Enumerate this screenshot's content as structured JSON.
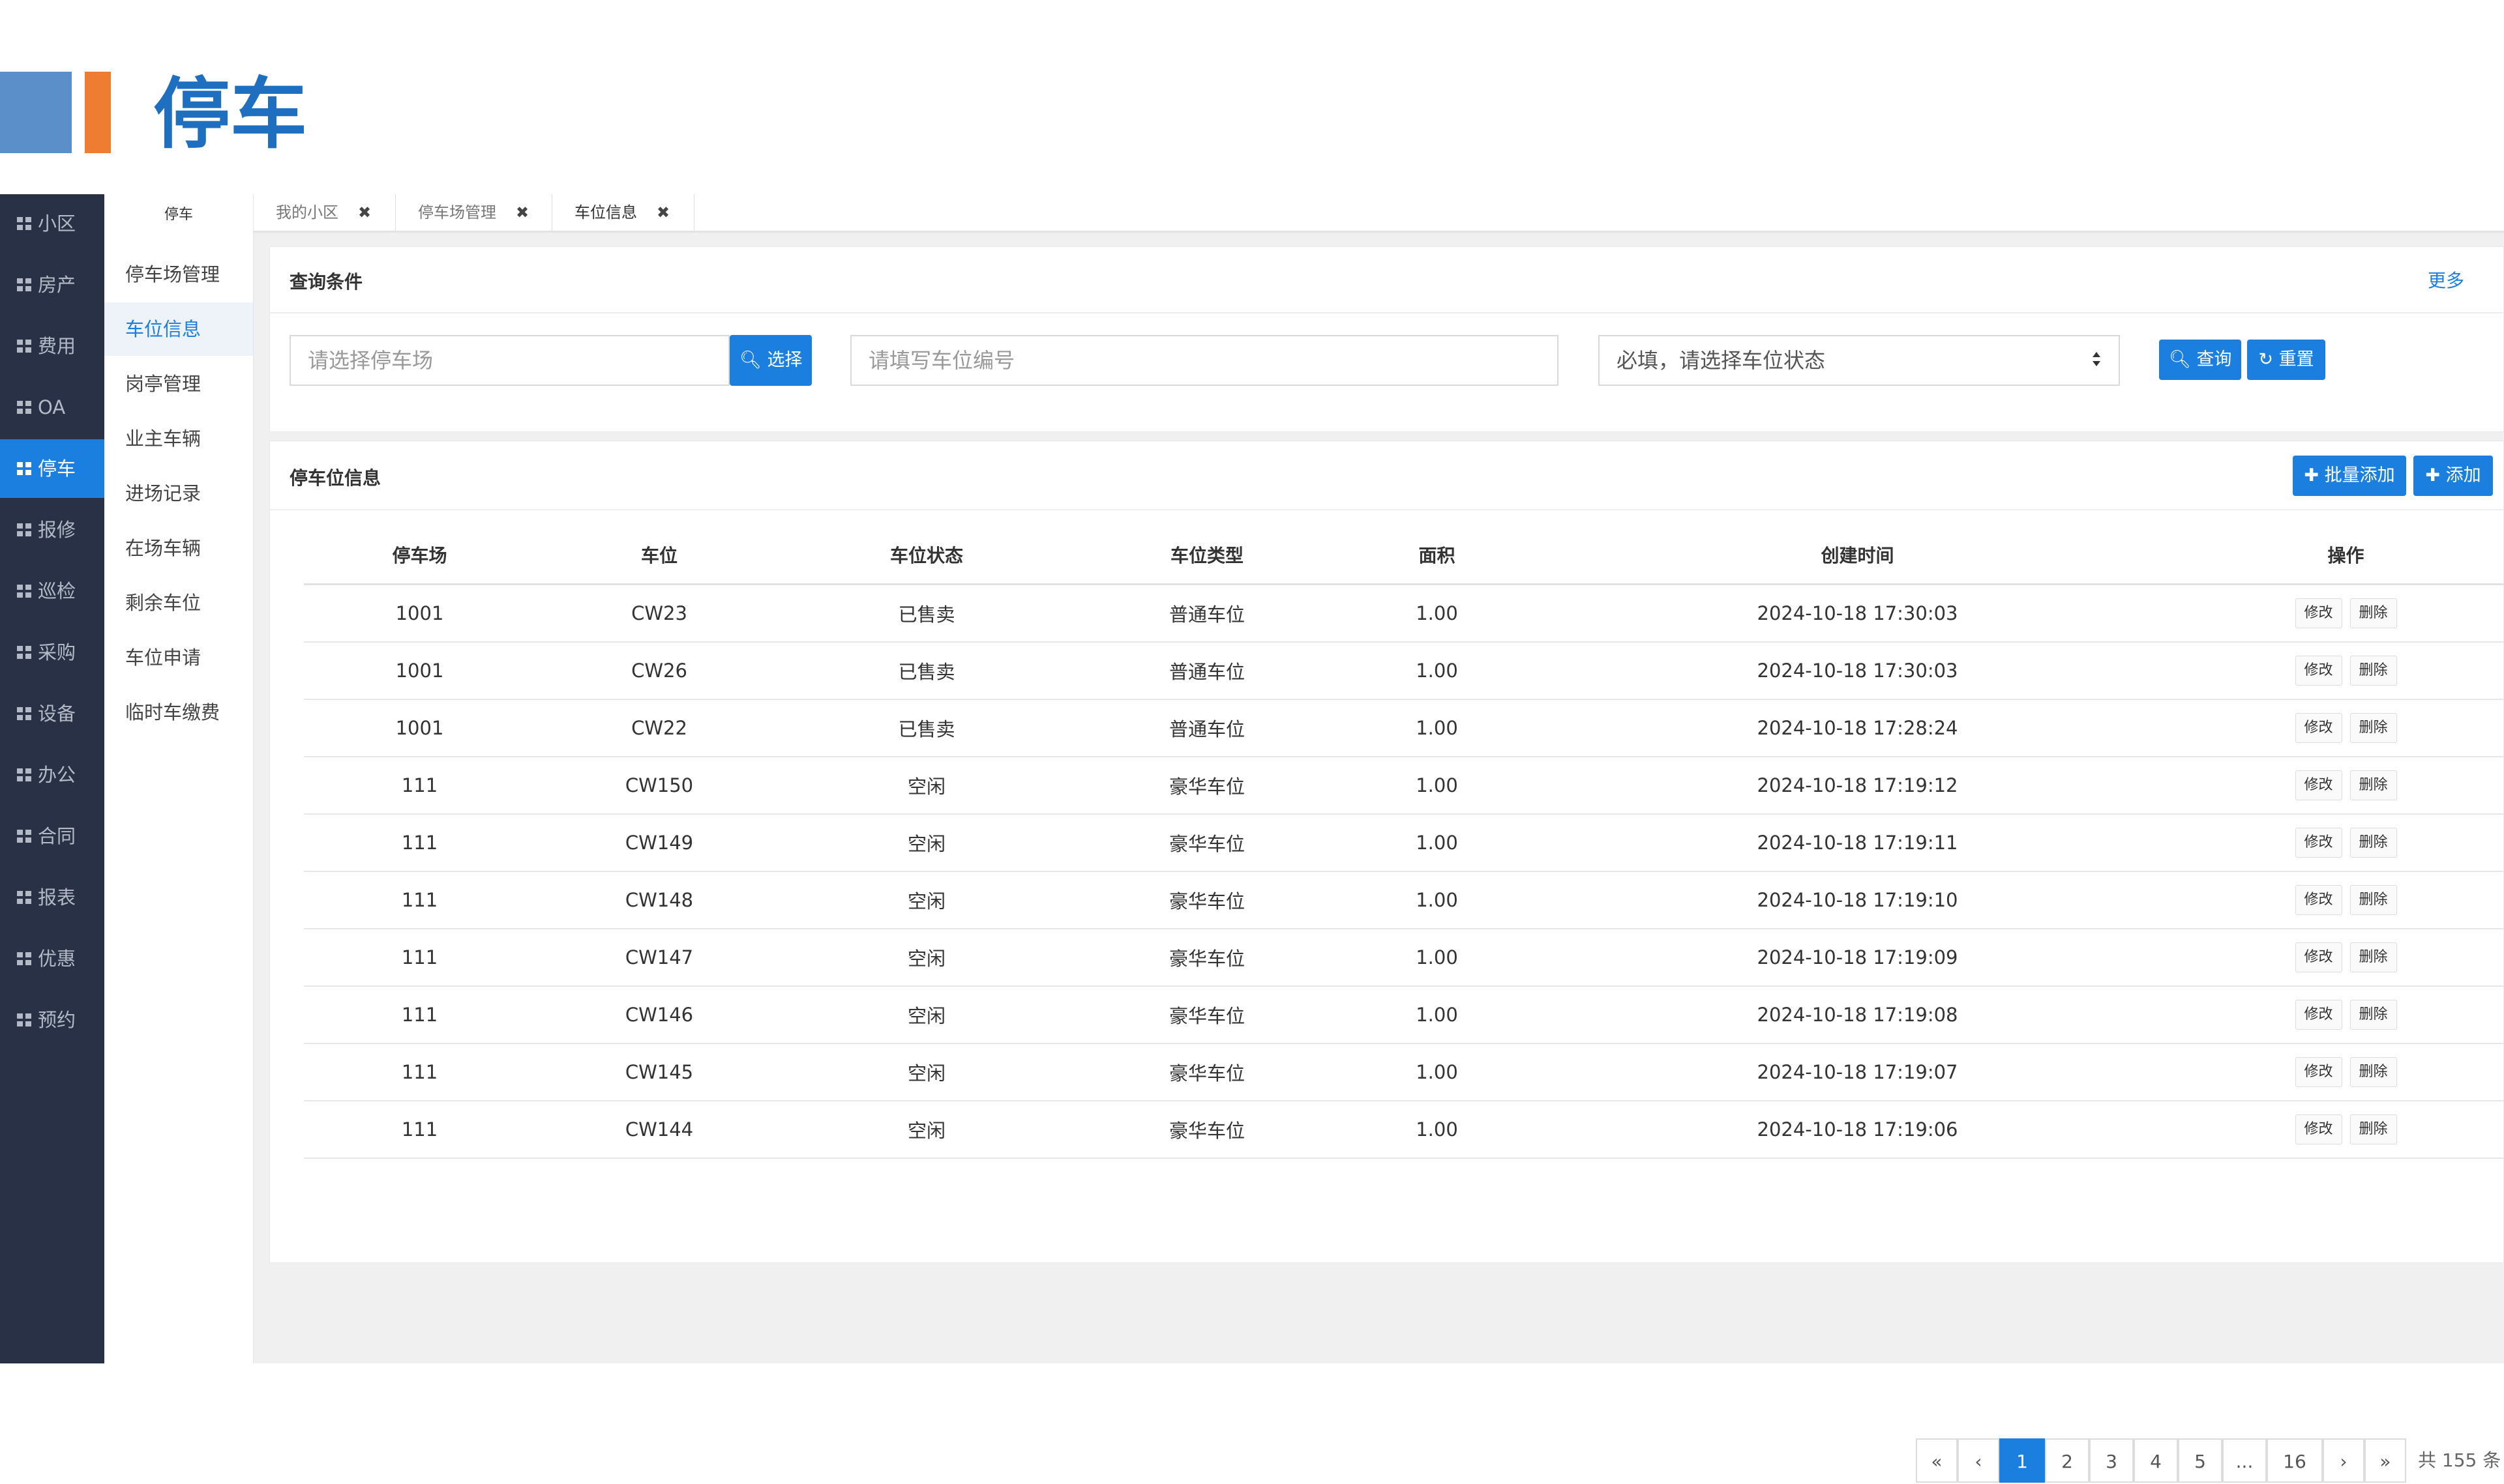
{
  "slide": {
    "title": "停车"
  },
  "nav": {
    "items": [
      {
        "label": "小区"
      },
      {
        "label": "房产"
      },
      {
        "label": "费用"
      },
      {
        "label": "OA"
      },
      {
        "label": "停车"
      },
      {
        "label": "报修"
      },
      {
        "label": "巡检"
      },
      {
        "label": "采购"
      },
      {
        "label": "设备"
      },
      {
        "label": "办公"
      },
      {
        "label": "合同"
      },
      {
        "label": "报表"
      },
      {
        "label": "优惠"
      },
      {
        "label": "预约"
      }
    ]
  },
  "subnav": {
    "title": "停车",
    "items": [
      {
        "label": "停车场管理"
      },
      {
        "label": "车位信息"
      },
      {
        "label": "岗亭管理"
      },
      {
        "label": "业主车辆"
      },
      {
        "label": "进场记录"
      },
      {
        "label": "在场车辆"
      },
      {
        "label": "剩余车位"
      },
      {
        "label": "车位申请"
      },
      {
        "label": "临时车缴费"
      }
    ]
  },
  "tabs": [
    {
      "label": "我的小区",
      "close": "✖"
    },
    {
      "label": "停车场管理",
      "close": "✖"
    },
    {
      "label": "车位信息",
      "close": "✖"
    }
  ],
  "query": {
    "title": "查询条件",
    "more": "更多",
    "lot_placeholder": "请选择停车场",
    "choose_label": "选择",
    "space_placeholder": "请填写车位编号",
    "status_value": "必填，请选择车位状态",
    "search_label": "查询",
    "reset_label": "重置"
  },
  "list": {
    "title": "停车位信息",
    "batch_add_label": "批量添加",
    "add_label": "添加",
    "columns": [
      "停车场",
      "车位",
      "车位状态",
      "车位类型",
      "面积",
      "创建时间",
      "操作"
    ],
    "rows": [
      [
        "1001",
        "CW23",
        "已售卖",
        "普通车位",
        "1.00",
        "2024-10-18 17:30:03"
      ],
      [
        "1001",
        "CW26",
        "已售卖",
        "普通车位",
        "1.00",
        "2024-10-18 17:30:03"
      ],
      [
        "1001",
        "CW22",
        "已售卖",
        "普通车位",
        "1.00",
        "2024-10-18 17:28:24"
      ],
      [
        "111",
        "CW150",
        "空闲",
        "豪华车位",
        "1.00",
        "2024-10-18 17:19:12"
      ],
      [
        "111",
        "CW149",
        "空闲",
        "豪华车位",
        "1.00",
        "2024-10-18 17:19:11"
      ],
      [
        "111",
        "CW148",
        "空闲",
        "豪华车位",
        "1.00",
        "2024-10-18 17:19:10"
      ],
      [
        "111",
        "CW147",
        "空闲",
        "豪华车位",
        "1.00",
        "2024-10-18 17:19:09"
      ],
      [
        "111",
        "CW146",
        "空闲",
        "豪华车位",
        "1.00",
        "2024-10-18 17:19:08"
      ],
      [
        "111",
        "CW145",
        "空闲",
        "豪华车位",
        "1.00",
        "2024-10-18 17:19:07"
      ],
      [
        "111",
        "CW144",
        "空闲",
        "豪华车位",
        "1.00",
        "2024-10-18 17:19:06"
      ]
    ],
    "edit_label": "修改",
    "delete_label": "删除"
  },
  "pagination": {
    "first": "«",
    "prev": "‹",
    "pages": [
      "1",
      "2",
      "3",
      "4",
      "5",
      "...",
      "16"
    ],
    "current": "1",
    "next": "›",
    "last": "»",
    "total": "共 155 条"
  },
  "colors": {
    "accent": "#1b7fe0",
    "sidebar": "#293146",
    "title": "#1f6fc0",
    "header_blue": "#5b8fc9",
    "header_orange": "#ee7d31"
  }
}
